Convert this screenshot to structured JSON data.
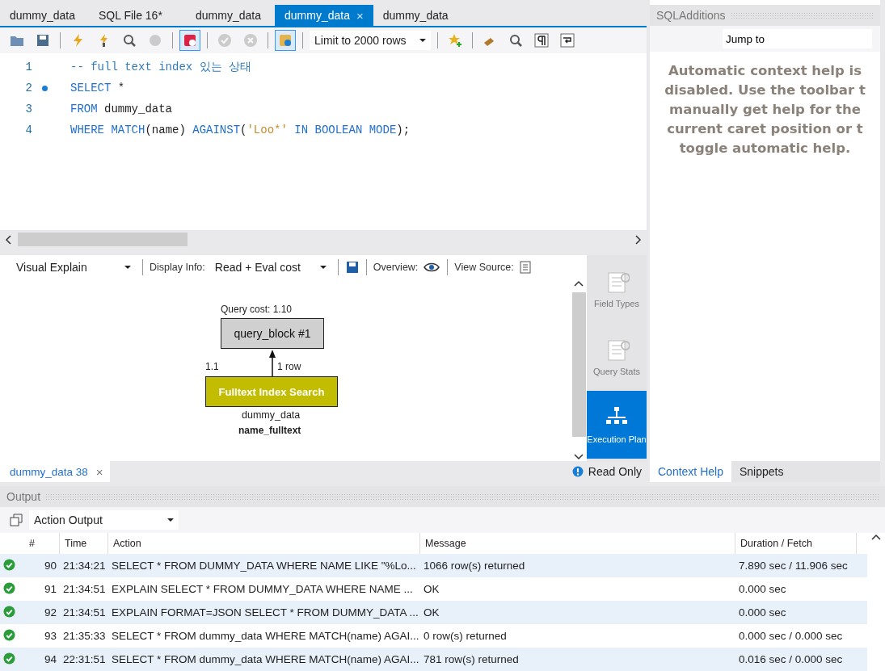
{
  "editor_tabs": [
    {
      "label": "dummy_data",
      "selected": false
    },
    {
      "label": "SQL File 16*",
      "selected": false
    },
    {
      "label": "dummy_data",
      "selected": false
    },
    {
      "label": "dummy_data",
      "selected": true,
      "close": "×"
    },
    {
      "label": "dummy_data",
      "selected": false
    }
  ],
  "toolbar": {
    "buttons": [
      {
        "toggled": false,
        "disabled": false
      },
      {
        "toggled": false,
        "disabled": false
      },
      {
        "toggled": false,
        "disabled": false
      },
      {
        "toggled": false,
        "disabled": false
      },
      {
        "toggled": false,
        "disabled": false
      },
      {
        "toggled": false,
        "disabled": true
      },
      {
        "toggled": true,
        "disabled": false
      },
      {
        "toggled": false,
        "disabled": true
      },
      {
        "toggled": false,
        "disabled": true
      },
      {
        "toggled": true,
        "disabled": false
      }
    ],
    "limit": "Limit to 2000 rows",
    "extra_buttons": [
      {
        "toggled": false
      },
      {
        "toggled": false
      },
      {
        "toggled": false
      },
      {
        "toggled": false
      },
      {
        "toggled": false
      }
    ]
  },
  "code_lines": [
    {
      "number": "1",
      "marker": false,
      "tokens": [
        {
          "kind": "comment",
          "text": "-- full text index 있는 상태"
        }
      ]
    },
    {
      "number": "2",
      "marker": true,
      "tokens": [
        {
          "kind": "keyword",
          "text": "SELECT"
        },
        {
          "kind": "plain",
          "text": " *"
        }
      ]
    },
    {
      "number": "3",
      "marker": false,
      "tokens": [
        {
          "kind": "keyword",
          "text": "FROM"
        },
        {
          "kind": "plain",
          "text": " dummy_data"
        }
      ]
    },
    {
      "number": "4",
      "marker": false,
      "tokens": [
        {
          "kind": "keyword",
          "text": "WHERE MATCH"
        },
        {
          "kind": "plain",
          "text": "(name) "
        },
        {
          "kind": "keyword",
          "text": "AGAINST"
        },
        {
          "kind": "plain",
          "text": "("
        },
        {
          "kind": "string",
          "text": "'Loo*'"
        },
        {
          "kind": "keyword",
          "text": " IN BOOLEAN MODE"
        },
        {
          "kind": "plain",
          "text": ");"
        }
      ]
    }
  ],
  "explain_toolbar": {
    "view": "Visual Explain",
    "display_label": "Display Info:",
    "display_value": "Read + Eval cost",
    "overview_label": "Overview:",
    "source_label": "View Source:"
  },
  "diagram": {
    "cost_label": "Query cost: 1.10",
    "block": "query_block #1",
    "edge_cost": "1.1",
    "edge_rows": "1 row",
    "operation": "Fulltext Index Search",
    "table": "dummy_data",
    "index": "name_fulltext"
  },
  "side_rail": [
    {
      "label": "Field Types",
      "selected": false
    },
    {
      "label": "Query Stats",
      "selected": false
    },
    {
      "label": "Execution Plan",
      "selected": true
    }
  ],
  "result_tabs": [
    {
      "label": "dummy_data 38",
      "selected": true,
      "close": "×"
    }
  ],
  "read_only": "Read Only",
  "sql_additions": {
    "title": "SQLAdditions",
    "jump_to": "Jump to",
    "help_lines": [
      "Automatic context help is",
      "disabled. Use the toolbar t",
      "manually get help for the",
      "current caret position or t",
      "toggle automatic help."
    ],
    "tabs": [
      {
        "label": "Context Help",
        "selected": true
      },
      {
        "label": "Snippets",
        "selected": false
      }
    ]
  },
  "output": {
    "title": "Output",
    "view": "Action Output",
    "columns": [
      "#",
      "Time",
      "Action",
      "Message",
      "Duration / Fetch"
    ],
    "rows": [
      {
        "ok": true,
        "number": "90",
        "time": "21:34:21",
        "action": "SELECT * FROM DUMMY_DATA  WHERE NAME LIKE \"%Lo...",
        "message": "1066 row(s) returned",
        "duration": "7.890 sec / 11.906 sec"
      },
      {
        "ok": true,
        "number": "91",
        "time": "21:34:51",
        "action": "EXPLAIN SELECT * FROM DUMMY_DATA  WHERE NAME ...",
        "message": "OK",
        "duration": "0.000 sec"
      },
      {
        "ok": true,
        "number": "92",
        "time": "21:34:51",
        "action": "EXPLAIN FORMAT=JSON SELECT * FROM DUMMY_DATA ...",
        "message": "OK",
        "duration": "0.000 sec"
      },
      {
        "ok": true,
        "number": "93",
        "time": "21:35:33",
        "action": "SELECT * FROM dummy_data WHERE MATCH(name) AGAI...",
        "message": "0 row(s) returned",
        "duration": "0.000 sec / 0.000 sec"
      },
      {
        "ok": true,
        "number": "94",
        "time": "22:31:51",
        "action": "SELECT * FROM dummy_data WHERE MATCH(name) AGAI...",
        "message": "781 row(s) returned",
        "duration": "0.016 sec / 0.000 sec"
      }
    ]
  }
}
